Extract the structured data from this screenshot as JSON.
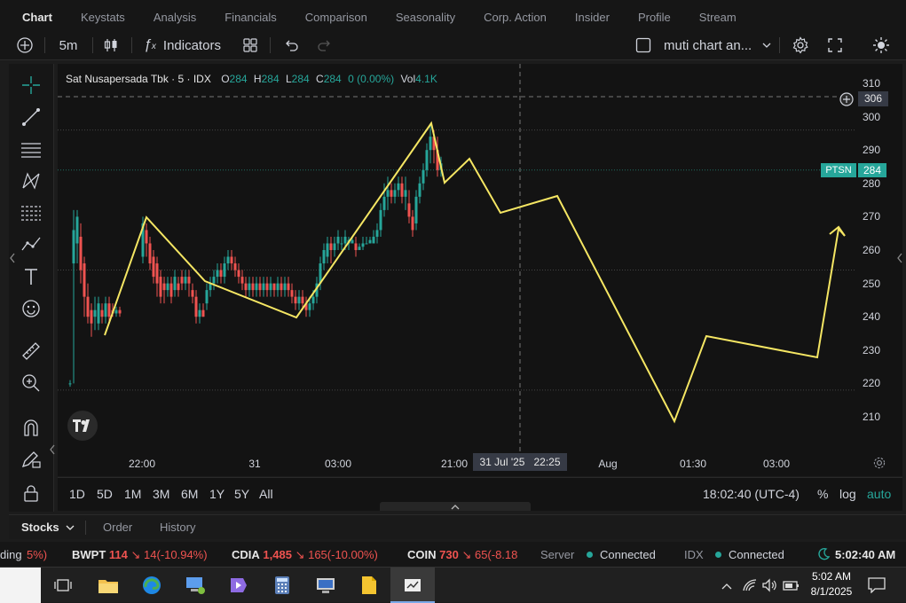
{
  "tabs": [
    "Chart",
    "Keystats",
    "Analysis",
    "Financials",
    "Comparison",
    "Seasonality",
    "Corp. Action",
    "Insider",
    "Profile",
    "Stream"
  ],
  "toolbar": {
    "interval": "5m",
    "indicators_label": "Indicators",
    "layout_name": "muti chart an..."
  },
  "legend": {
    "symbol": "Sat Nusapersada Tbk · 5 · IDX",
    "o_label": "O",
    "o_value": "284",
    "h_label": "H",
    "h_value": "284",
    "l_label": "L",
    "l_value": "284",
    "c_label": "C",
    "c_value": "284",
    "change": "0 (0.00%)",
    "vol_label": "Vol",
    "vol_value": "4.1K"
  },
  "price_axis": {
    "ticks": [
      "310",
      "300",
      "290",
      "280",
      "270",
      "260",
      "250",
      "240",
      "230",
      "220",
      "210"
    ],
    "crosshair_value": "306",
    "symbol_tag": "PTSN",
    "last_price": "284"
  },
  "time_axis": {
    "ticks": [
      "22:00",
      "31",
      "03:00",
      "21:00",
      "Aug",
      "01:30",
      "03:00"
    ],
    "crosshair_label": "31 Jul '25   22:25"
  },
  "ranges": [
    "1D",
    "5D",
    "1M",
    "3M",
    "6M",
    "1Y",
    "5Y",
    "All"
  ],
  "bottom_right": {
    "clock": "18:02:40 (UTC-4)",
    "percent": "%",
    "log": "log",
    "auto": "auto"
  },
  "panel_tabs": {
    "stocks": "Stocks",
    "order": "Order",
    "history": "History"
  },
  "ticker": {
    "lead": "ding",
    "lead_pct": "5%)",
    "items": [
      {
        "sym": "BWPT",
        "price": "114",
        "chg": "↘ 14",
        "pct": "(-10.94%)"
      },
      {
        "sym": "CDIA",
        "price": "1,485",
        "chg": "↘ 165",
        "pct": "(-10.00%)"
      },
      {
        "sym": "COIN",
        "price": "730",
        "chg": "↘ 65",
        "pct": "(-8.18"
      }
    ],
    "server_label": "Server",
    "server_status": "Connected",
    "idx_label": "IDX",
    "idx_status": "Connected",
    "time": "5:02:40 AM"
  },
  "taskbar": {
    "time": "5:02 AM",
    "date": "8/1/2025"
  },
  "colors": {
    "up": "#26a69a",
    "down": "#ef5350",
    "drawing": "#f5e663",
    "accent": "#26a69a"
  }
}
